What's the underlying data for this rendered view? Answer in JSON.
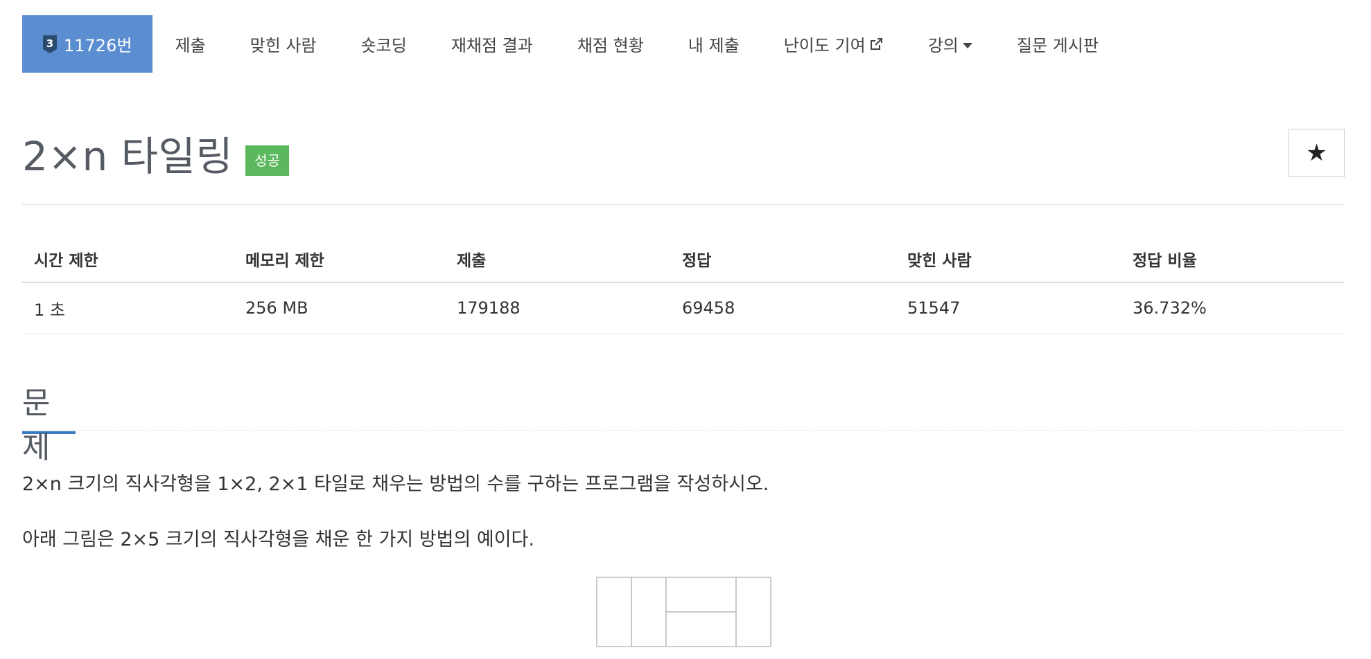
{
  "menu": {
    "tier_number": "3",
    "problem_id": "11726번",
    "items": [
      "제출",
      "맞힌 사람",
      "숏코딩",
      "재채점 결과",
      "채점 현황",
      "내 제출",
      "난이도 기여",
      "강의",
      "질문 게시판"
    ],
    "tier_color": "#2a4a6e",
    "active_color": "#5b8ed1"
  },
  "problem": {
    "title": "2×n 타일링",
    "result_badge": "성공",
    "star_label": "★"
  },
  "info_table": {
    "headers": [
      "시간 제한",
      "메모리 제한",
      "제출",
      "정답",
      "맞힌 사람",
      "정답 비율"
    ],
    "values": [
      "1 초",
      "256 MB",
      "179188",
      "69458",
      "51547",
      "36.732%"
    ]
  },
  "section": {
    "title": "문제"
  },
  "description": {
    "line1": "2×n 크기의 직사각형을 1×2, 2×1 타일로 채우는 방법의 수를 구하는 프로그램을 작성하시오.",
    "line2": "아래 그림은 2×5 크기의 직사각형을 채운 한 가지 방법의 예이다."
  },
  "icons": {
    "external_link": "external-link-icon",
    "dropdown": "caret-down-icon",
    "tier": "tier-badge-icon"
  }
}
